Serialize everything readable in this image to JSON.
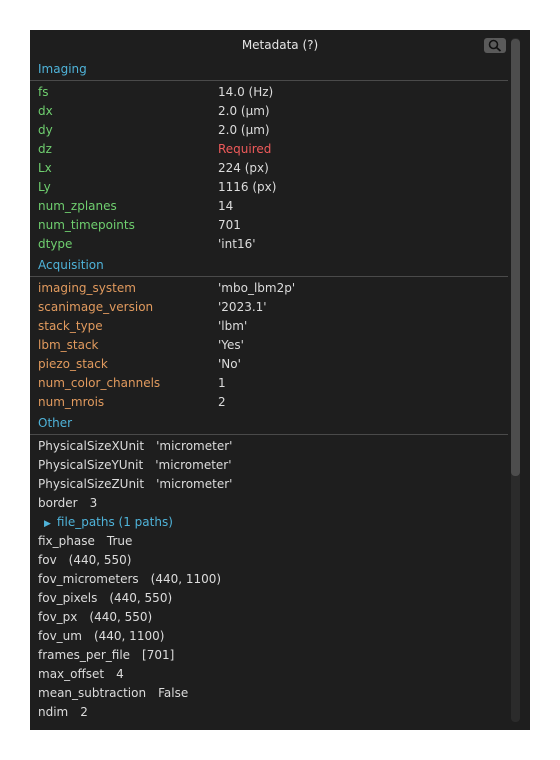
{
  "window": {
    "title": "Metadata (?)"
  },
  "icons": {
    "search": "search-icon"
  },
  "sections": {
    "imaging": {
      "label": "Imaging",
      "rows": [
        {
          "key": "fs",
          "value": "14.0 (Hz)"
        },
        {
          "key": "dx",
          "value": "2.0 (µm)"
        },
        {
          "key": "dy",
          "value": "2.0 (µm)"
        },
        {
          "key": "dz",
          "value": "Required"
        },
        {
          "key": "Lx",
          "value": "224 (px)"
        },
        {
          "key": "Ly",
          "value": "1116 (px)"
        },
        {
          "key": "num_zplanes",
          "value": "14"
        },
        {
          "key": "num_timepoints",
          "value": "701"
        },
        {
          "key": "dtype",
          "value": "'int16'"
        }
      ]
    },
    "acquisition": {
      "label": "Acquisition",
      "rows": [
        {
          "key": "imaging_system",
          "value": "'mbo_lbm2p'"
        },
        {
          "key": "scanimage_version",
          "value": "'2023.1'"
        },
        {
          "key": "stack_type",
          "value": "'lbm'"
        },
        {
          "key": "lbm_stack",
          "value": "'Yes'"
        },
        {
          "key": "piezo_stack",
          "value": "'No'"
        },
        {
          "key": "num_color_channels",
          "value": "1"
        },
        {
          "key": "num_mrois",
          "value": "2"
        }
      ]
    },
    "other": {
      "label": "Other",
      "rows_before": [
        {
          "key": "PhysicalSizeXUnit",
          "value": "'micrometer'"
        },
        {
          "key": "PhysicalSizeYUnit",
          "value": "'micrometer'"
        },
        {
          "key": "PhysicalSizeZUnit",
          "value": "'micrometer'"
        },
        {
          "key": "border",
          "value": "3"
        }
      ],
      "tree_node": {
        "label": "file_paths (1 paths)"
      },
      "rows_after": [
        {
          "key": "fix_phase",
          "value": "True"
        },
        {
          "key": "fov",
          "value": "(440, 550)"
        },
        {
          "key": "fov_micrometers",
          "value": "(440, 1100)"
        },
        {
          "key": "fov_pixels",
          "value": "(440, 550)"
        },
        {
          "key": "fov_px",
          "value": "(440, 550)"
        },
        {
          "key": "fov_um",
          "value": "(440, 1100)"
        },
        {
          "key": "frames_per_file",
          "value": "[701]"
        },
        {
          "key": "max_offset",
          "value": "4"
        },
        {
          "key": "mean_subtraction",
          "value": "False"
        },
        {
          "key": "ndim",
          "value": "2"
        }
      ]
    }
  },
  "colors": {
    "panel_bg": "#1e1e1e",
    "section_header": "#4fb3d9",
    "imaging_key": "#6fcf6f",
    "acquisition_key": "#e19a5e",
    "required_value": "#ef5a5a"
  }
}
